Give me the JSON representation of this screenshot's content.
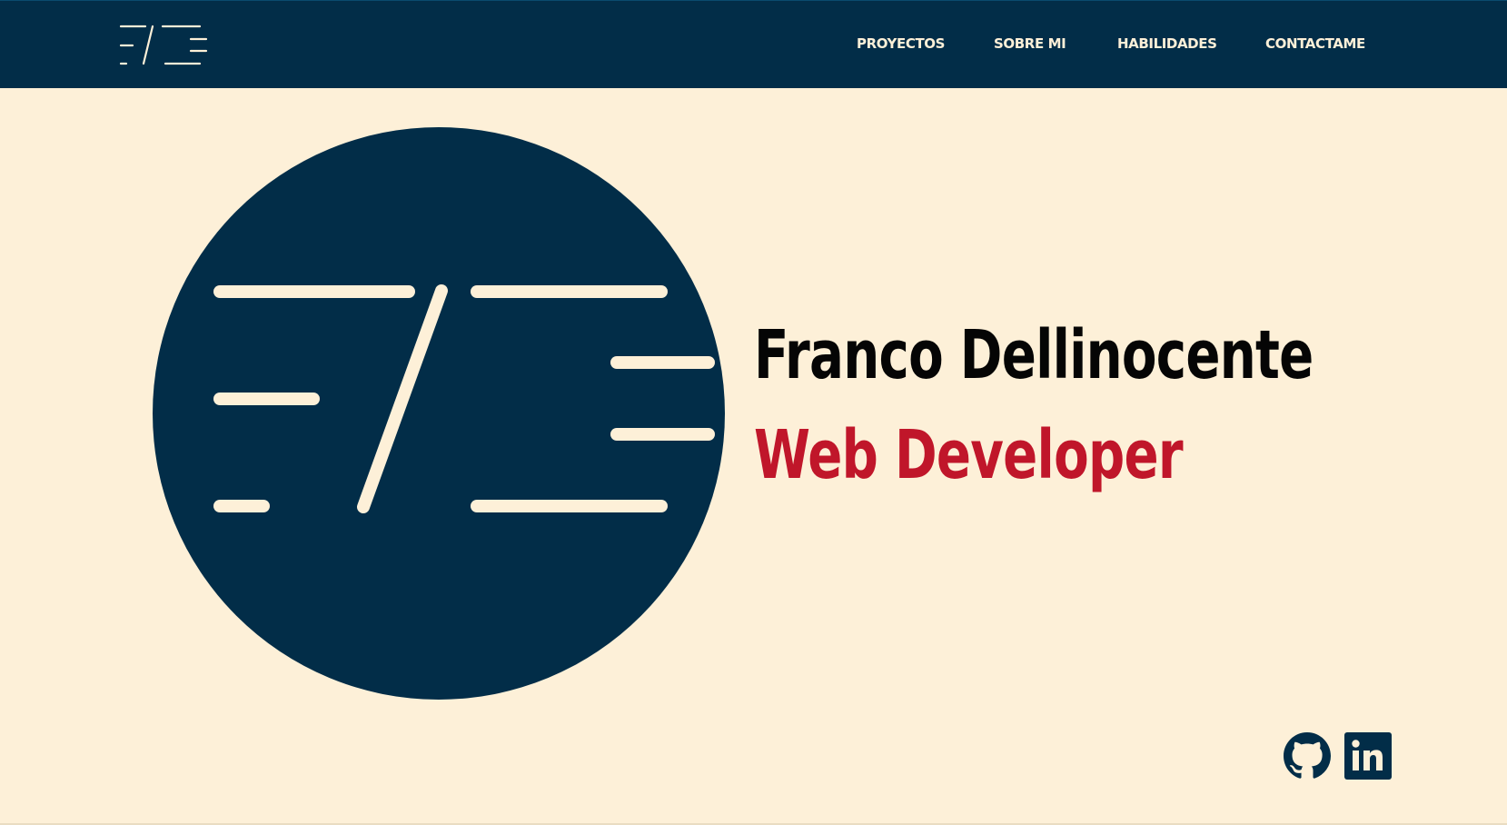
{
  "colors": {
    "navbar_bg": "#022d48",
    "page_bg": "#fdf0d8",
    "name_color": "#050505",
    "role_color": "#c0162a",
    "logo_fg": "#fdf0d8"
  },
  "nav": {
    "logo_icon": "fd-monogram-logo-icon",
    "links": [
      {
        "label": "PROYECTOS"
      },
      {
        "label": "SOBRE MI"
      },
      {
        "label": "HABILIDADES"
      },
      {
        "label": "CONTACTAME"
      }
    ]
  },
  "hero": {
    "logo_icon": "fd-monogram-circle-logo-icon",
    "name": "Franco Dellinocente",
    "role": "Web Developer"
  },
  "social": [
    {
      "icon": "github-icon"
    },
    {
      "icon": "linkedin-icon"
    }
  ]
}
